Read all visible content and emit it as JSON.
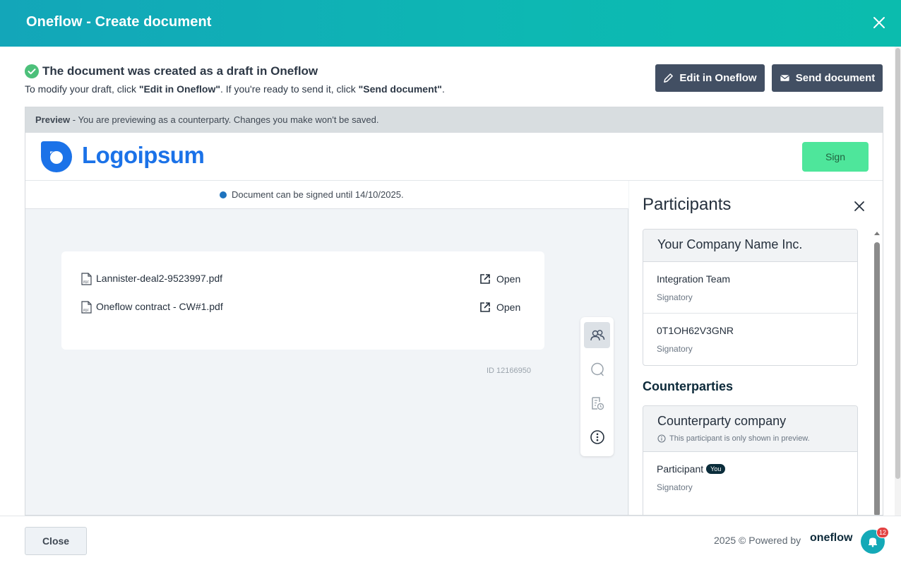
{
  "modal": {
    "title": "Oneflow - Create document"
  },
  "status": {
    "title": "The document was created as a draft in Oneflow",
    "sub_prefix": "To modify your draft, click ",
    "sub_edit": "\"Edit in Oneflow\"",
    "sub_middle": ". If you're ready to send it, click ",
    "sub_send": "\"Send document\"",
    "sub_suffix": "."
  },
  "actions": {
    "edit_label": "Edit in Oneflow",
    "send_label": "Send document"
  },
  "preview": {
    "banner_bold": "Preview",
    "banner_text": " - You are previewing as a counterparty. Changes you make won't be saved.",
    "logo_text": "Logoipsum",
    "sign_label": "Sign",
    "deadline": "Document can be signed until 14/10/2025.",
    "files": [
      {
        "name": "Lannister-deal2-9523997.pdf",
        "action": "Open"
      },
      {
        "name": "Oneflow contract - CW#1.pdf",
        "action": "Open"
      }
    ],
    "doc_id": "ID 12166950"
  },
  "toolbar": {
    "icons": [
      "participants-icon",
      "comment-icon",
      "audit-trail-icon",
      "more-info-icon"
    ]
  },
  "participants": {
    "title": "Participants",
    "own_company": {
      "name": "Your Company Name Inc.",
      "members": [
        {
          "name": "Integration Team",
          "role": "Signatory"
        },
        {
          "name": "0T1OH62V3GNR",
          "role": "Signatory"
        }
      ]
    },
    "counterparties_title": "Counterparties",
    "counterparty": {
      "name": "Counterparty company",
      "note": "This participant is only shown in preview.",
      "members": [
        {
          "name": "Participant",
          "badge": "You",
          "role": "Signatory"
        }
      ]
    }
  },
  "footer": {
    "close_label": "Close",
    "powered_text": "2025 © Powered by",
    "brand": "oneflow",
    "notifications": "12"
  },
  "colors": {
    "header_gradient_start": "#13a6b9",
    "header_gradient_end": "#0bbcae",
    "button_dark": "#424f63",
    "sign_green": "#4ee69b",
    "logo_blue": "#1b72e8",
    "success_green": "#4cc07a",
    "badge_red": "#e34242"
  }
}
